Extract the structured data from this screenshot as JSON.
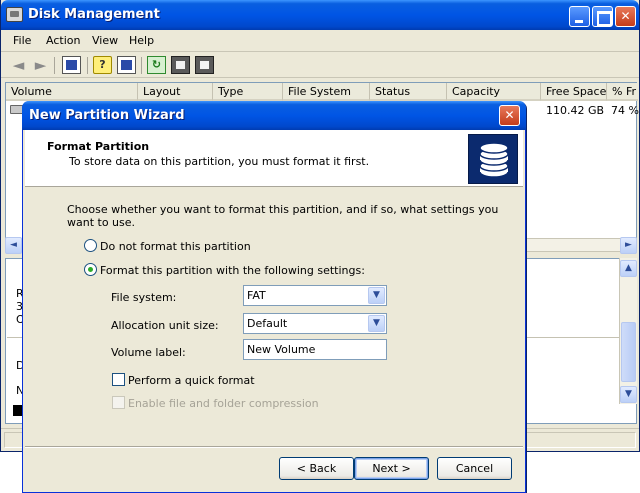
{
  "main_window": {
    "title": "Disk Management",
    "menu": [
      "File",
      "Action",
      "View",
      "Help"
    ],
    "columns": [
      "Volume",
      "Layout",
      "Type",
      "File System",
      "Status",
      "Capacity",
      "Free Space",
      "% Fr"
    ],
    "row": {
      "free_space": "110.42 GB",
      "percent_free": "74 %"
    },
    "disk_labels": {
      "d0_line1": "R",
      "d0_line2": "3",
      "d0_line3": "O",
      "d1_line1": "D",
      "d1_line2": "N"
    }
  },
  "wizard": {
    "title": "New Partition Wizard",
    "close_glyph": "✕",
    "heading": "Format Partition",
    "subheading": "To store data on this partition, you must format it first.",
    "prompt": "Choose whether you want to format this partition, and if so, what settings you want to use.",
    "options": {
      "do_not_format": "Do not format this partition",
      "format_with": "Format this partition with the following settings:"
    },
    "fields": {
      "file_system_label": "File system:",
      "file_system_value": "FAT",
      "allocation_label": "Allocation unit size:",
      "allocation_value": "Default",
      "volume_label_label": "Volume label:",
      "volume_label_value": "New Volume"
    },
    "checkboxes": {
      "quick_format": "Perform a quick format",
      "compression": "Enable file and folder compression"
    },
    "buttons": {
      "back": "< Back",
      "next": "Next >",
      "cancel": "Cancel"
    }
  },
  "colors": {
    "titlebar": "#0055e5",
    "dialog_face": "#ece9d8",
    "emblem_bg": "#0b2a6e",
    "radio_dot": "#2bab2b"
  }
}
